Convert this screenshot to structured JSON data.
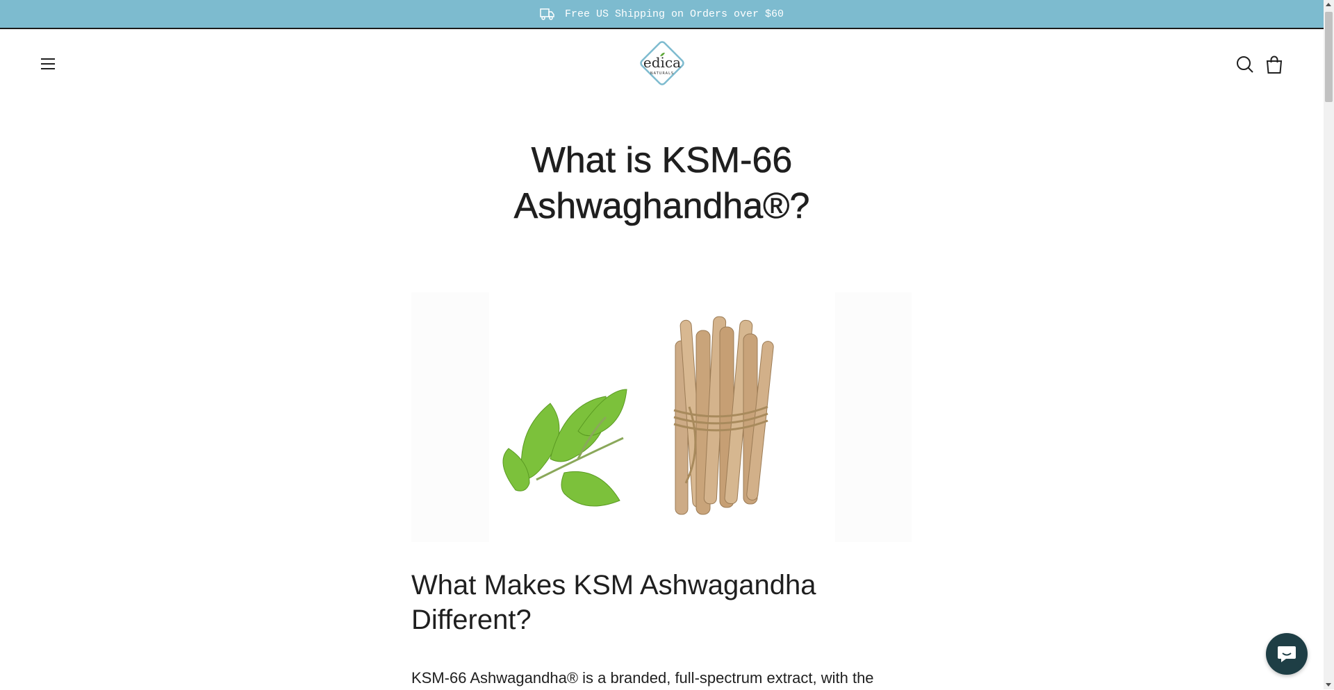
{
  "announcement": {
    "text": "Free US Shipping on Orders over $60",
    "icon": "truck-icon",
    "background": "#7dbbcf"
  },
  "header": {
    "menu_icon": "hamburger-menu-icon",
    "logo": {
      "brand": "edica",
      "tagline": "NATURALS",
      "accent": "#7dbbcf"
    },
    "search_icon": "search-icon",
    "cart_icon": "shopping-bag-icon"
  },
  "page": {
    "title_line1": "What is KSM-66",
    "title_line2": "Ashwaghandha®?",
    "hero_image": "ashwagandha-roots-and-leaves",
    "section_heading_line1": "What Makes KSM Ashwagandha",
    "section_heading_line2": "Different?",
    "body_text": "KSM-66 Ashwagandha® is a branded, full-spectrum extract, with the"
  },
  "chat": {
    "icon": "chat-bubble-icon",
    "color": "#1e3e45"
  }
}
